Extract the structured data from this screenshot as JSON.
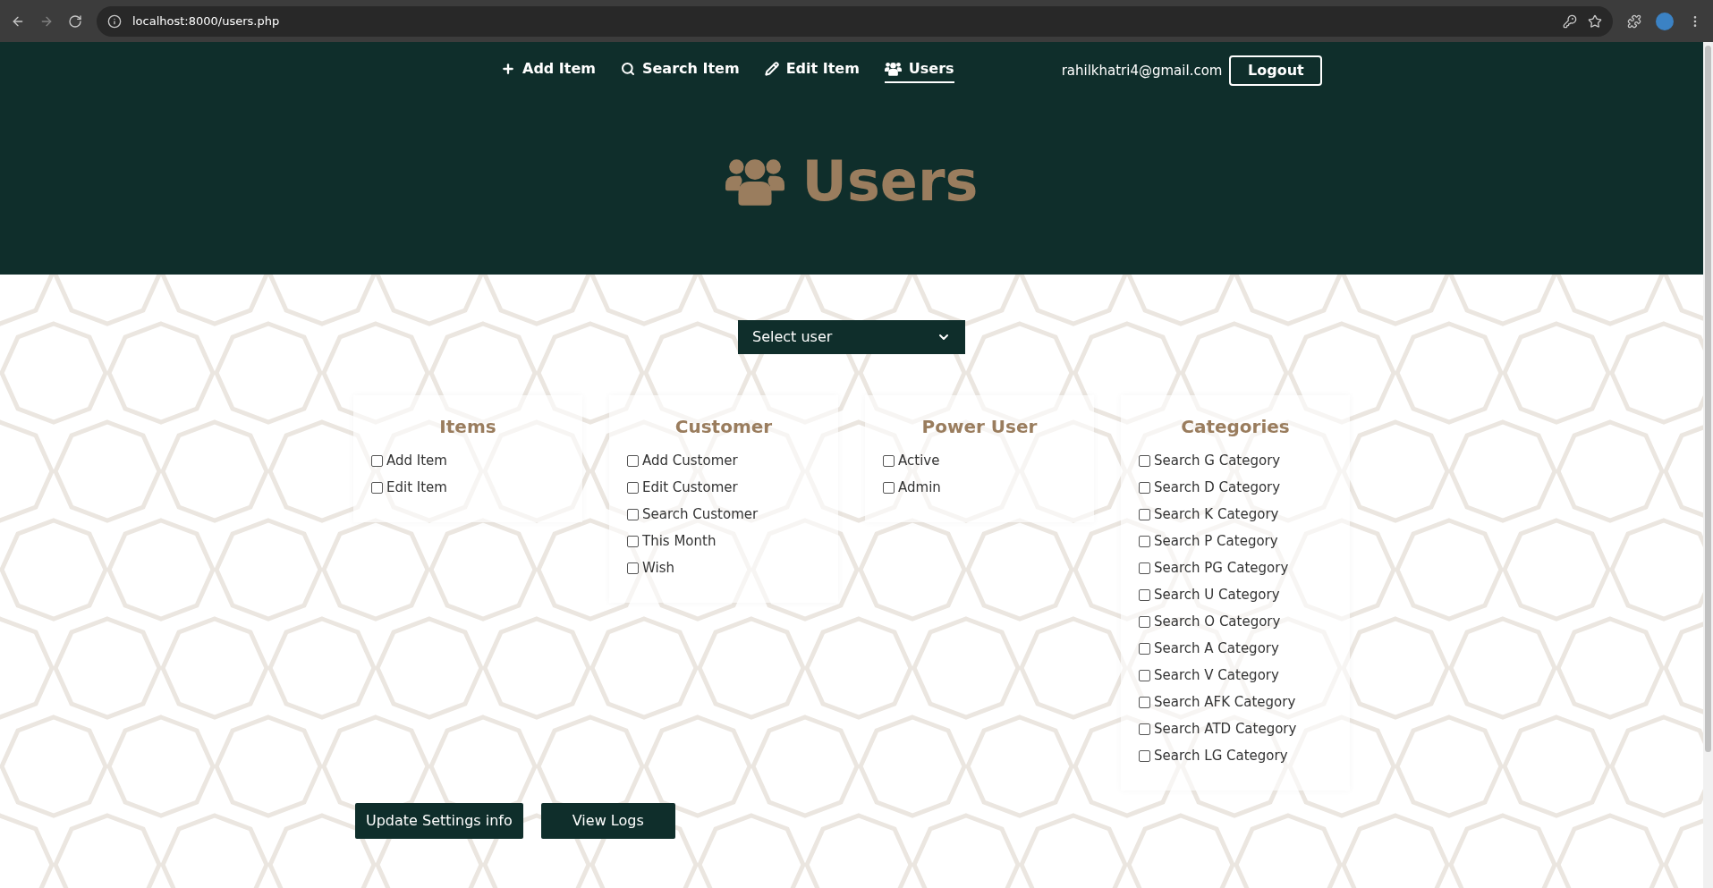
{
  "browser": {
    "url": "localhost:8000/users.php"
  },
  "nav": {
    "links": [
      {
        "label": "Add Item",
        "selected": false
      },
      {
        "label": "Search Item",
        "selected": false
      },
      {
        "label": "Edit Item",
        "selected": false
      },
      {
        "label": "Users",
        "selected": true
      }
    ],
    "email": "rahilkhatri4@gmail.com",
    "logout": "Logout"
  },
  "title": "Users",
  "user_select": {
    "value": "Select user"
  },
  "groups": [
    {
      "title": "Items",
      "options": [
        {
          "label": "Add Item",
          "checked": false
        },
        {
          "label": "Edit Item",
          "checked": false
        }
      ]
    },
    {
      "title": "Customer",
      "options": [
        {
          "label": "Add Customer",
          "checked": false
        },
        {
          "label": "Edit Customer",
          "checked": false
        },
        {
          "label": "Search Customer",
          "checked": false
        },
        {
          "label": "This Month",
          "checked": false
        },
        {
          "label": "Wish",
          "checked": false
        }
      ]
    },
    {
      "title": "Power User",
      "options": [
        {
          "label": "Active",
          "checked": false
        },
        {
          "label": "Admin",
          "checked": false
        }
      ]
    },
    {
      "title": "Categories",
      "options": [
        {
          "label": "Search G Category",
          "checked": false
        },
        {
          "label": "Search D Category",
          "checked": false
        },
        {
          "label": "Search K Category",
          "checked": false
        },
        {
          "label": "Search P Category",
          "checked": false
        },
        {
          "label": "Search PG Category",
          "checked": false
        },
        {
          "label": "Search U Category",
          "checked": false
        },
        {
          "label": "Search O Category",
          "checked": false
        },
        {
          "label": "Search A Category",
          "checked": false
        },
        {
          "label": "Search V Category",
          "checked": false
        },
        {
          "label": "Search AFK Category",
          "checked": false
        },
        {
          "label": "Search ATD Category",
          "checked": false
        },
        {
          "label": "Search LG Category",
          "checked": false
        }
      ]
    }
  ],
  "buttons": [
    "Update Settings info",
    "View Logs"
  ]
}
